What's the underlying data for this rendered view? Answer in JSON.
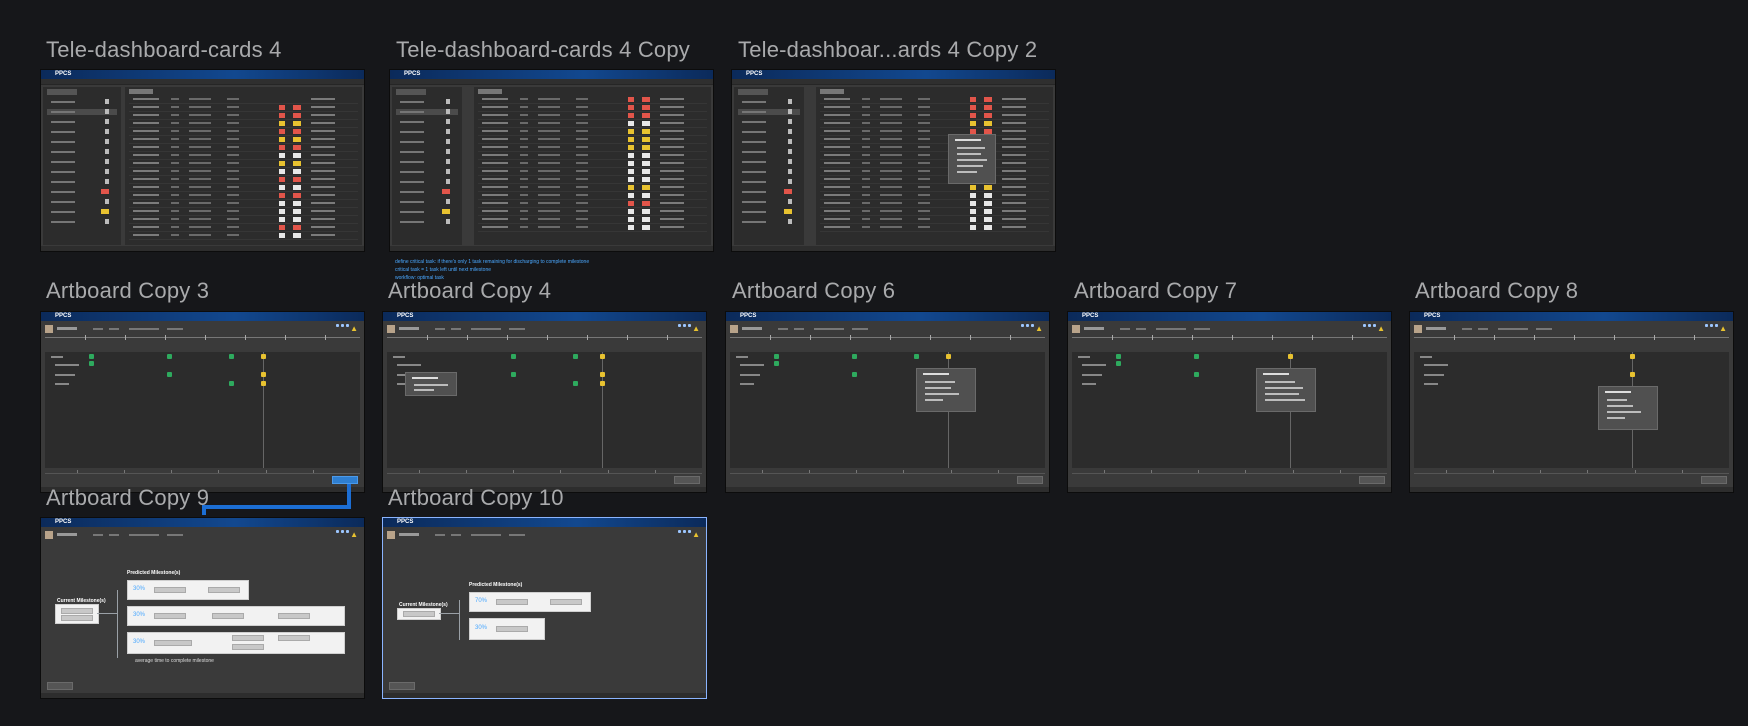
{
  "canvas": {
    "background": "#16171a",
    "accent_connector": "#1c6ed4"
  },
  "artboards": {
    "dash1": {
      "title": "Tele-dashboard-cards 4"
    },
    "dash2": {
      "title": "Tele-dashboard-cards 4 Copy"
    },
    "dash3": {
      "title": "Tele-dashboar...ards 4 Copy 2"
    },
    "copy3": {
      "title": "Artboard Copy 3"
    },
    "copy4": {
      "title": "Artboard Copy 4"
    },
    "copy6": {
      "title": "Artboard Copy 6"
    },
    "copy7": {
      "title": "Artboard Copy 7"
    },
    "copy8": {
      "title": "Artboard Copy 8"
    },
    "copy9": {
      "title": "Artboard Copy 9"
    },
    "copy10": {
      "title": "Artboard Copy 10"
    }
  },
  "app": {
    "brand": "PPCS"
  },
  "note": {
    "lines": [
      "define critical task: if there's only 1 task remaining for discharging to complete milestone",
      "critical task = 1 task left until next milestone",
      "workflow: optimal task"
    ]
  },
  "flow": {
    "current_label": "Current Milestone(s)",
    "predicted_label": "Predicted Milestone(s)",
    "copy9_pcts": [
      "30%",
      "30%",
      "30%"
    ],
    "copy10_pcts": [
      "70%",
      "30%"
    ],
    "caption": "average time to complete milestone"
  }
}
